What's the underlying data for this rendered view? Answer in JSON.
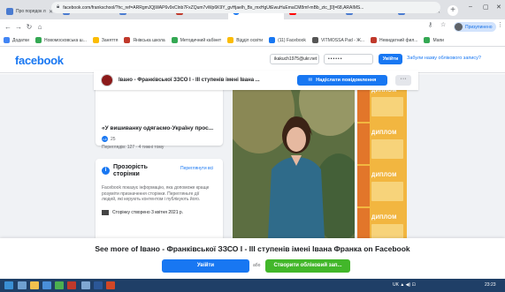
{
  "browser": {
    "tabs": [
      {
        "label": "Про порядок лист",
        "color": "#4a7bd0"
      },
      {
        "label": "Про затвердженн",
        "color": "#4a7bd0"
      },
      {
        "label": "Наказ про визнач",
        "color": "#4a7bd0"
      },
      {
        "label": "Робота соціальн",
        "color": "#c0392b"
      },
      {
        "label": "Івано - Франківс",
        "color": "#1877f2",
        "active": true
      },
      {
        "label": "7_01 клас Біолог",
        "color": "#ff0000"
      },
      {
        "label": "Про затвердженн",
        "color": "#4a7bd0"
      },
      {
        "label": "Про затвердженн",
        "color": "#4a7bd0"
      }
    ],
    "url": "facebook.com/frankschool/?hc_ref=ARRgmJQjWAP6v9xClnb7FxZQum7vWp6K9Y_gvHjaelh_Bs_mxHgUtEwuHuEmaCM8mf-mBb_ztc_[0]=68,ARAIMS...",
    "profile_label": "Призупинено",
    "bookmarks": [
      {
        "label": "Додатки",
        "color": "#4285f4"
      },
      {
        "label": "Новомосковська ш...",
        "color": "#34a853"
      },
      {
        "label": "Заняття",
        "color": "#fbbc05"
      },
      {
        "label": "Янівська школа",
        "color": "#c0392b"
      },
      {
        "label": "Методичний кабінет",
        "color": "#34a853"
      },
      {
        "label": "Відділ освіти",
        "color": "#fbbc05"
      },
      {
        "label": "(11) Facebook",
        "color": "#1877f2"
      },
      {
        "label": "VITMOSSA Pad - Ж...",
        "color": "#555555"
      },
      {
        "label": "Невидатний фил...",
        "color": "#c0392b"
      },
      {
        "label": "Мапи",
        "color": "#34a853"
      }
    ]
  },
  "fb": {
    "logo": "facebook",
    "email_value": "ikakuch1975@ukr.net",
    "password_value": "••••••",
    "login_label": "Увійти",
    "forgot_label": "Забули назву облікового запису?",
    "page_name": "Івано - Франківської ЗЗСО I - III ступенів імені Івана ...",
    "message_label": "Надіслати повідомлення",
    "more_label": "···",
    "post": {
      "title": "«У вишиванку одягаємо-Україну прос...",
      "likes": "25",
      "views": "Переглядів: 127 · 4 тижні тому"
    },
    "transparency": {
      "title": "Прозорість сторінки",
      "see_all": "Переглянути всі",
      "description": "Facebook показує інформацію, яка допоможе краще розуміти призначення сторінки. Перегляньте дії людей, які керують контентом і публікують його.",
      "created": "Сторінку створено 3 квітня 2021 р."
    },
    "diploma_label": "ДИПЛОМ",
    "prompt": {
      "text": "See more of Івано - Франківської ЗЗСО I - III ступенів імені Івана Франка on Facebook",
      "login": "Увійти",
      "or": "або",
      "create": "Створити обліковий зап..."
    }
  },
  "taskbar": {
    "tray": "UK  ▲  ◀)  ⊡",
    "clock": "23:23"
  }
}
